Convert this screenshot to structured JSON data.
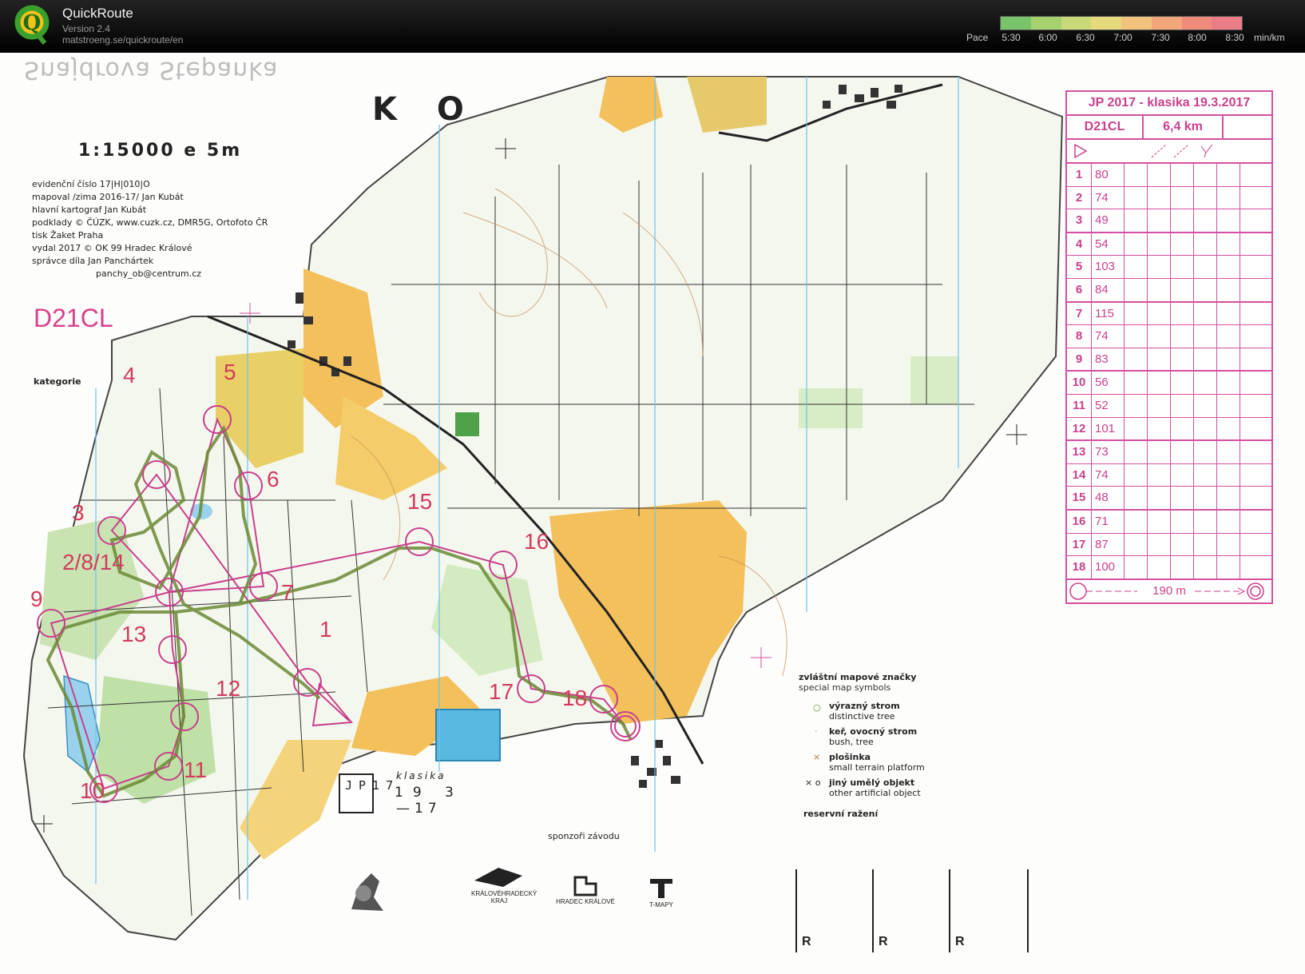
{
  "app": {
    "name": "QuickRoute",
    "version": "Version 2.4",
    "url": "matstroeng.se/quickroute/en"
  },
  "pace_scale": {
    "label": "Pace",
    "ticks": [
      "5:30",
      "6:00",
      "6:30",
      "7:00",
      "7:30",
      "8:00",
      "8:30"
    ],
    "unit": "min/km",
    "colors": [
      "#79c46a",
      "#a6d16f",
      "#c9d977",
      "#e6d97b",
      "#f0c27c",
      "#f2a77b",
      "#ef8b7b",
      "#ea7d86"
    ]
  },
  "map": {
    "ghost_name": "Snajdrova Stepanka",
    "title": "K O",
    "scale": "1:15000  e 5m",
    "meta": [
      "evidenční číslo 17|H|010|O",
      "mapoval /zima 2016-17/ Jan Kubát",
      "hlavní kartograf Jan Kubát",
      "podklady © ČÚZK, www.cuzk.cz, DMR5G, Ortofoto ČR",
      "tisk Žaket Praha",
      "vydal 2017 © OK 99 Hradec Králové",
      "správce díla Jan Panchártek",
      "panchy_ob@centrum.cz"
    ],
    "class_title": "D21CL",
    "category_label": "kategorie",
    "controls": [
      "4",
      "5",
      "6",
      "3",
      "2/8/14",
      "7",
      "9",
      "13",
      "1",
      "12",
      "11",
      "10",
      "15",
      "16",
      "17",
      "18"
    ]
  },
  "control_description": {
    "event": "JP 2017 - klasika 19.3.2017",
    "course": "D21CL",
    "length": "6,4 km",
    "rows": [
      {
        "seq": "1",
        "code": "80"
      },
      {
        "seq": "2",
        "code": "74"
      },
      {
        "seq": "3",
        "code": "49"
      },
      {
        "seq": "4",
        "code": "54"
      },
      {
        "seq": "5",
        "code": "103"
      },
      {
        "seq": "6",
        "code": "84"
      },
      {
        "seq": "7",
        "code": "115"
      },
      {
        "seq": "8",
        "code": "74"
      },
      {
        "seq": "9",
        "code": "83"
      },
      {
        "seq": "10",
        "code": "56"
      },
      {
        "seq": "11",
        "code": "52"
      },
      {
        "seq": "12",
        "code": "101"
      },
      {
        "seq": "13",
        "code": "73"
      },
      {
        "seq": "14",
        "code": "74"
      },
      {
        "seq": "15",
        "code": "48"
      },
      {
        "seq": "16",
        "code": "71"
      },
      {
        "seq": "17",
        "code": "87"
      },
      {
        "seq": "18",
        "code": "100"
      }
    ],
    "finish": "190 m"
  },
  "legend": {
    "title": "zvláštní mapové značky",
    "subtitle": "special map symbols",
    "items": [
      {
        "cz": "výrazný strom",
        "en": "distinctive tree"
      },
      {
        "cz": "keř, ovocný strom",
        "en": "bush, tree"
      },
      {
        "cz": "plošinka",
        "en": "small terrain platform"
      },
      {
        "cz": "jiný umělý objekt",
        "en": "other artificial object"
      }
    ]
  },
  "footer": {
    "jp_logo": "JP17",
    "race_type": "klasika",
    "race_day": "19 3",
    "race_year": "—17",
    "reserve_label": "reservní ražení",
    "reserve_boxes": [
      "R",
      "R",
      "R"
    ],
    "sponsors_label": "sponzoři závodu",
    "sponsors": [
      "KRÁLOVÉHRADECKÝ KRAJ",
      "HRADEC KRÁLOVÉ",
      "T-MAPY"
    ]
  }
}
